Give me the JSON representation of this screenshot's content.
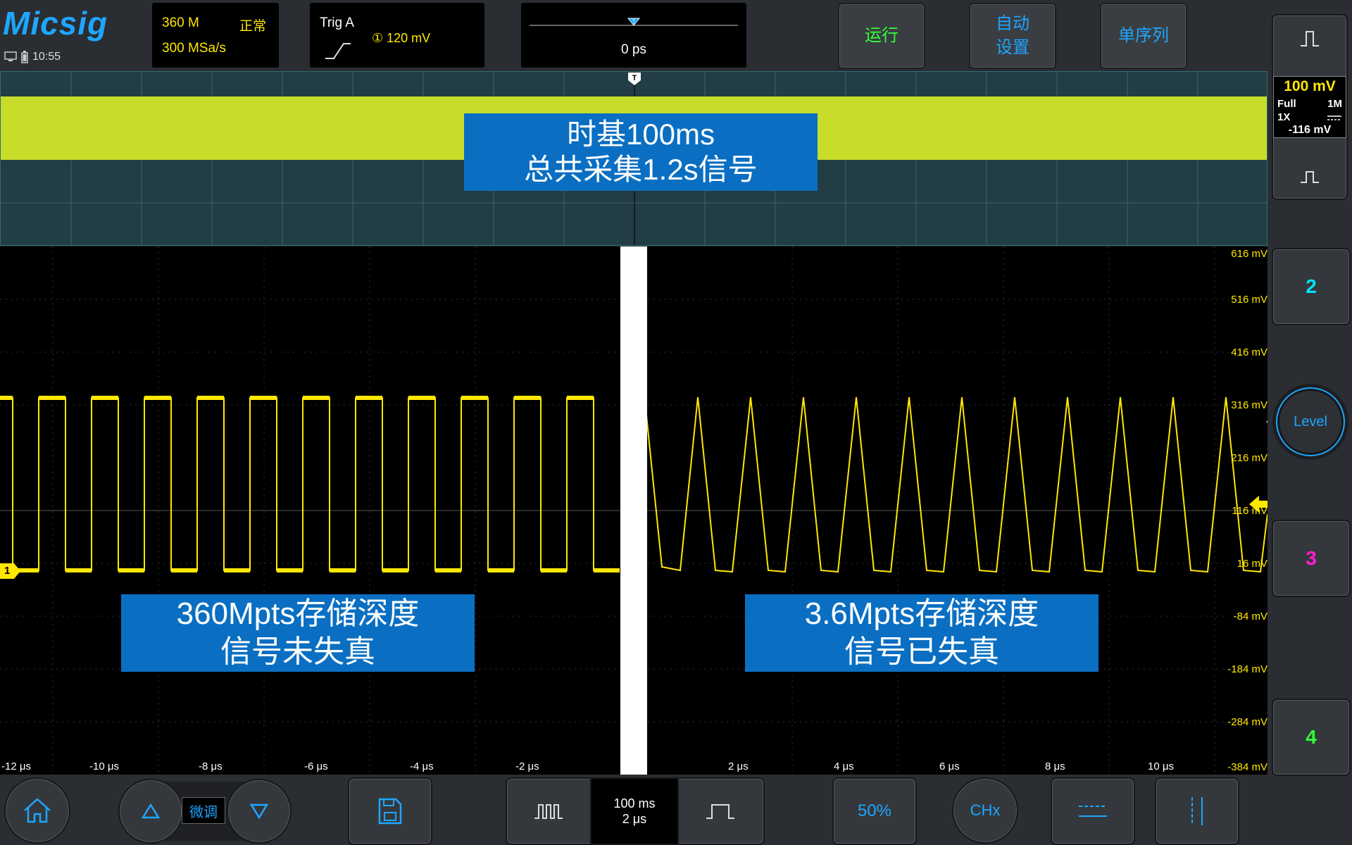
{
  "brand": "Micsig",
  "status": {
    "time": "10:55"
  },
  "acquisition": {
    "memory": "360 M",
    "mode": "正常",
    "sample_rate": "300 MSa/s"
  },
  "trigger": {
    "label": "Trig  A",
    "level": "① 120 mV"
  },
  "time_position": {
    "value": "0 ps"
  },
  "top_buttons": {
    "run": "运行",
    "auto_line1": "自动",
    "auto_line2": "设置",
    "single": "单序列"
  },
  "channel1": {
    "scale": "100 mV",
    "bandwidth": "Full",
    "impedance": "1M",
    "probe": "1X",
    "offset": "-116 mV",
    "marker": "1"
  },
  "channels": {
    "ch2": "2",
    "ch3": "3",
    "ch4": "4"
  },
  "level_button": "Level",
  "overview_caption": {
    "line1": "时基100ms",
    "line2": "总共采集1.2s信号"
  },
  "left_caption": {
    "line1": "360Mpts存储深度",
    "line2": "信号未失真"
  },
  "right_caption": {
    "line1": "3.6Mpts存储深度",
    "line2": "信号已失真"
  },
  "y_axis_labels": [
    "616 mV",
    "516 mV",
    "416 mV",
    "316 mV",
    "216 mV",
    "116 mV",
    "16 mV",
    "-84 mV",
    "-184 mV",
    "-284 mV",
    "-384 mV"
  ],
  "x_axis_labels": [
    "-12 μs",
    "-10 μs",
    "-8 μs",
    "-6 μs",
    "-4 μs",
    "-2 μs",
    "2 μs",
    "4 μs",
    "6 μs",
    "8 μs",
    "10 μs"
  ],
  "bottom": {
    "fine_tune": "微调",
    "timebase_main": "100 ms",
    "timebase_zoom": "2 μs",
    "fifty_percent": "50%",
    "chx": "CHx"
  },
  "colors": {
    "ch1": "#ffe800",
    "ch2": "#00e5ff",
    "ch3": "#ff1fd1",
    "ch4": "#33ff33",
    "accent": "#1ea6ff",
    "run": "#33ff33"
  },
  "icons": [
    "home-icon",
    "up-arrow-icon",
    "down-arrow-icon",
    "save-icon",
    "pulse-wide-icon",
    "pulse-narrow-icon",
    "horizontal-cursor-icon",
    "vertical-cursor-icon",
    "level-icon"
  ]
}
